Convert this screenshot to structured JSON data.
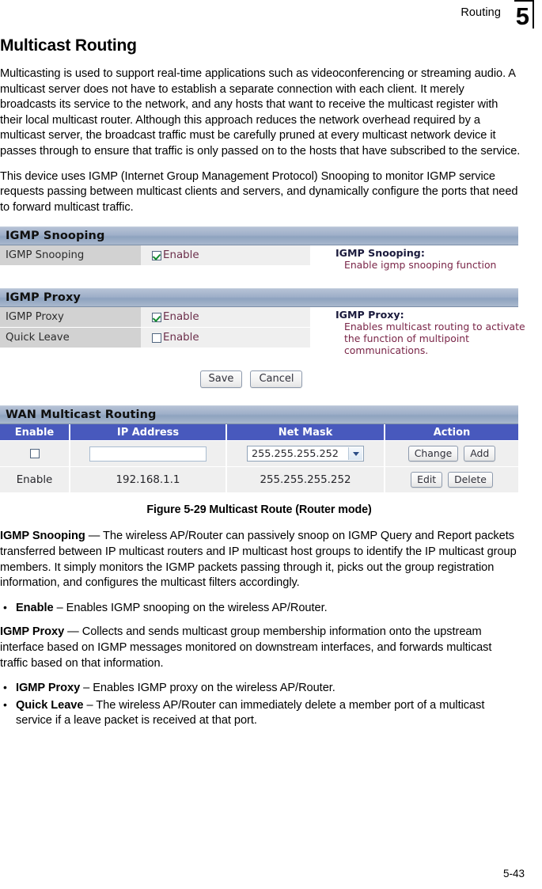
{
  "header": {
    "running_head": "Routing",
    "chapter_number": "5"
  },
  "section": {
    "title": "Multicast Routing",
    "paragraph_1": "Multicasting is used to support real-time applications such as videoconferencing or streaming audio. A multicast server does not have to establish a separate connection with each client. It merely broadcasts its service to the network, and any hosts that want to receive the multicast register with their local multicast router. Although this approach reduces the network overhead required by a multicast server, the broadcast traffic must be carefully pruned at every multicast network device it passes through to ensure that traffic is only passed on to the hosts that have subscribed to the service.",
    "paragraph_2": "This device uses IGMP (Internet Group Management Protocol) Snooping to monitor IGMP service requests passing between multicast clients and servers, and dynamically configure the ports that need to forward multicast traffic."
  },
  "figure": {
    "caption": "Figure 5-29  Multicast Route (Router mode)",
    "snooping_panel": {
      "bar_title": "IGMP Snooping",
      "row_label": "IGMP Snooping",
      "checkbox_label": "Enable",
      "checkbox_checked": true,
      "help_title": "IGMP Snooping:",
      "help_body": "Enable igmp snooping function"
    },
    "proxy_panel": {
      "bar_title": "IGMP Proxy",
      "rows": [
        {
          "label": "IGMP Proxy",
          "checkbox_label": "Enable",
          "checked": true
        },
        {
          "label": "Quick Leave",
          "checkbox_label": "Enable",
          "checked": false
        }
      ],
      "help_title": "IGMP Proxy:",
      "help_body": "Enables multicast routing to activate the function of multipoint communications."
    },
    "buttons": {
      "save": "Save",
      "cancel": "Cancel"
    },
    "wan_table": {
      "bar_title": "WAN Multicast Routing",
      "columns": [
        "Enable",
        "IP Address",
        "Net Mask",
        "Action"
      ],
      "input_row": {
        "enable_checked": false,
        "ip_value": "",
        "ip_placeholder": "",
        "netmask_selected": "255.255.255.252",
        "netmask_options": [
          "255.255.255.252"
        ],
        "action_primary": "Change",
        "action_secondary": "Add"
      },
      "data_rows": [
        {
          "enable": "Enable",
          "ip_address": "192.168.1.1",
          "net_mask": "255.255.255.252",
          "action_edit": "Edit",
          "action_delete": "Delete"
        }
      ]
    }
  },
  "descriptions": {
    "snooping_term": "IGMP Snooping",
    "snooping_text": " — The wireless AP/Router can passively snoop on IGMP Query and Report packets transferred between IP multicast routers and IP multicast host groups to identify the IP multicast group members. It simply monitors the IGMP packets passing through it, picks out the group registration information, and configures the multicast filters accordingly.",
    "snooping_bullet_term": "Enable",
    "snooping_bullet_text": " – Enables IGMP snooping on the wireless AP/Router.",
    "proxy_term": "IGMP Proxy",
    "proxy_text": " — Collects and sends multicast group membership information onto the upstream interface based on IGMP messages monitored on downstream interfaces, and forwards multicast traffic based on that information.",
    "proxy_bullet_term": "IGMP Proxy",
    "proxy_bullet_text": " – Enables IGMP proxy on the wireless AP/Router.",
    "quickleave_bullet_term": "Quick Leave",
    "quickleave_bullet_text": " – The wireless AP/Router can immediately delete a member port of a multicast service if a leave packet is received at that port."
  },
  "footer": {
    "page_number": "5-43"
  },
  "colors": {
    "panel_bar": "#9fb0c9",
    "table_header": "#4859bd",
    "label_cell": "#d2d2d2",
    "field_cell": "#efefef",
    "help_body": "#7a2648",
    "check_green": "#128a2e"
  }
}
